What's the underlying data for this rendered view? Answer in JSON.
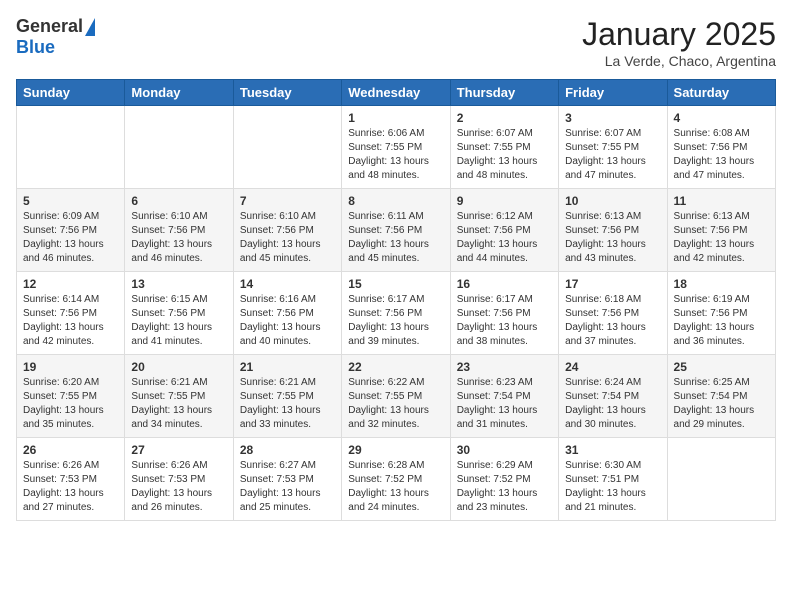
{
  "logo": {
    "general": "General",
    "blue": "Blue"
  },
  "header": {
    "month": "January 2025",
    "location": "La Verde, Chaco, Argentina"
  },
  "days_of_week": [
    "Sunday",
    "Monday",
    "Tuesday",
    "Wednesday",
    "Thursday",
    "Friday",
    "Saturday"
  ],
  "weeks": [
    [
      {
        "day": "",
        "info": ""
      },
      {
        "day": "",
        "info": ""
      },
      {
        "day": "",
        "info": ""
      },
      {
        "day": "1",
        "info": "Sunrise: 6:06 AM\nSunset: 7:55 PM\nDaylight: 13 hours\nand 48 minutes."
      },
      {
        "day": "2",
        "info": "Sunrise: 6:07 AM\nSunset: 7:55 PM\nDaylight: 13 hours\nand 48 minutes."
      },
      {
        "day": "3",
        "info": "Sunrise: 6:07 AM\nSunset: 7:55 PM\nDaylight: 13 hours\nand 47 minutes."
      },
      {
        "day": "4",
        "info": "Sunrise: 6:08 AM\nSunset: 7:56 PM\nDaylight: 13 hours\nand 47 minutes."
      }
    ],
    [
      {
        "day": "5",
        "info": "Sunrise: 6:09 AM\nSunset: 7:56 PM\nDaylight: 13 hours\nand 46 minutes."
      },
      {
        "day": "6",
        "info": "Sunrise: 6:10 AM\nSunset: 7:56 PM\nDaylight: 13 hours\nand 46 minutes."
      },
      {
        "day": "7",
        "info": "Sunrise: 6:10 AM\nSunset: 7:56 PM\nDaylight: 13 hours\nand 45 minutes."
      },
      {
        "day": "8",
        "info": "Sunrise: 6:11 AM\nSunset: 7:56 PM\nDaylight: 13 hours\nand 45 minutes."
      },
      {
        "day": "9",
        "info": "Sunrise: 6:12 AM\nSunset: 7:56 PM\nDaylight: 13 hours\nand 44 minutes."
      },
      {
        "day": "10",
        "info": "Sunrise: 6:13 AM\nSunset: 7:56 PM\nDaylight: 13 hours\nand 43 minutes."
      },
      {
        "day": "11",
        "info": "Sunrise: 6:13 AM\nSunset: 7:56 PM\nDaylight: 13 hours\nand 42 minutes."
      }
    ],
    [
      {
        "day": "12",
        "info": "Sunrise: 6:14 AM\nSunset: 7:56 PM\nDaylight: 13 hours\nand 42 minutes."
      },
      {
        "day": "13",
        "info": "Sunrise: 6:15 AM\nSunset: 7:56 PM\nDaylight: 13 hours\nand 41 minutes."
      },
      {
        "day": "14",
        "info": "Sunrise: 6:16 AM\nSunset: 7:56 PM\nDaylight: 13 hours\nand 40 minutes."
      },
      {
        "day": "15",
        "info": "Sunrise: 6:17 AM\nSunset: 7:56 PM\nDaylight: 13 hours\nand 39 minutes."
      },
      {
        "day": "16",
        "info": "Sunrise: 6:17 AM\nSunset: 7:56 PM\nDaylight: 13 hours\nand 38 minutes."
      },
      {
        "day": "17",
        "info": "Sunrise: 6:18 AM\nSunset: 7:56 PM\nDaylight: 13 hours\nand 37 minutes."
      },
      {
        "day": "18",
        "info": "Sunrise: 6:19 AM\nSunset: 7:56 PM\nDaylight: 13 hours\nand 36 minutes."
      }
    ],
    [
      {
        "day": "19",
        "info": "Sunrise: 6:20 AM\nSunset: 7:55 PM\nDaylight: 13 hours\nand 35 minutes."
      },
      {
        "day": "20",
        "info": "Sunrise: 6:21 AM\nSunset: 7:55 PM\nDaylight: 13 hours\nand 34 minutes."
      },
      {
        "day": "21",
        "info": "Sunrise: 6:21 AM\nSunset: 7:55 PM\nDaylight: 13 hours\nand 33 minutes."
      },
      {
        "day": "22",
        "info": "Sunrise: 6:22 AM\nSunset: 7:55 PM\nDaylight: 13 hours\nand 32 minutes."
      },
      {
        "day": "23",
        "info": "Sunrise: 6:23 AM\nSunset: 7:54 PM\nDaylight: 13 hours\nand 31 minutes."
      },
      {
        "day": "24",
        "info": "Sunrise: 6:24 AM\nSunset: 7:54 PM\nDaylight: 13 hours\nand 30 minutes."
      },
      {
        "day": "25",
        "info": "Sunrise: 6:25 AM\nSunset: 7:54 PM\nDaylight: 13 hours\nand 29 minutes."
      }
    ],
    [
      {
        "day": "26",
        "info": "Sunrise: 6:26 AM\nSunset: 7:53 PM\nDaylight: 13 hours\nand 27 minutes."
      },
      {
        "day": "27",
        "info": "Sunrise: 6:26 AM\nSunset: 7:53 PM\nDaylight: 13 hours\nand 26 minutes."
      },
      {
        "day": "28",
        "info": "Sunrise: 6:27 AM\nSunset: 7:53 PM\nDaylight: 13 hours\nand 25 minutes."
      },
      {
        "day": "29",
        "info": "Sunrise: 6:28 AM\nSunset: 7:52 PM\nDaylight: 13 hours\nand 24 minutes."
      },
      {
        "day": "30",
        "info": "Sunrise: 6:29 AM\nSunset: 7:52 PM\nDaylight: 13 hours\nand 23 minutes."
      },
      {
        "day": "31",
        "info": "Sunrise: 6:30 AM\nSunset: 7:51 PM\nDaylight: 13 hours\nand 21 minutes."
      },
      {
        "day": "",
        "info": ""
      }
    ]
  ]
}
